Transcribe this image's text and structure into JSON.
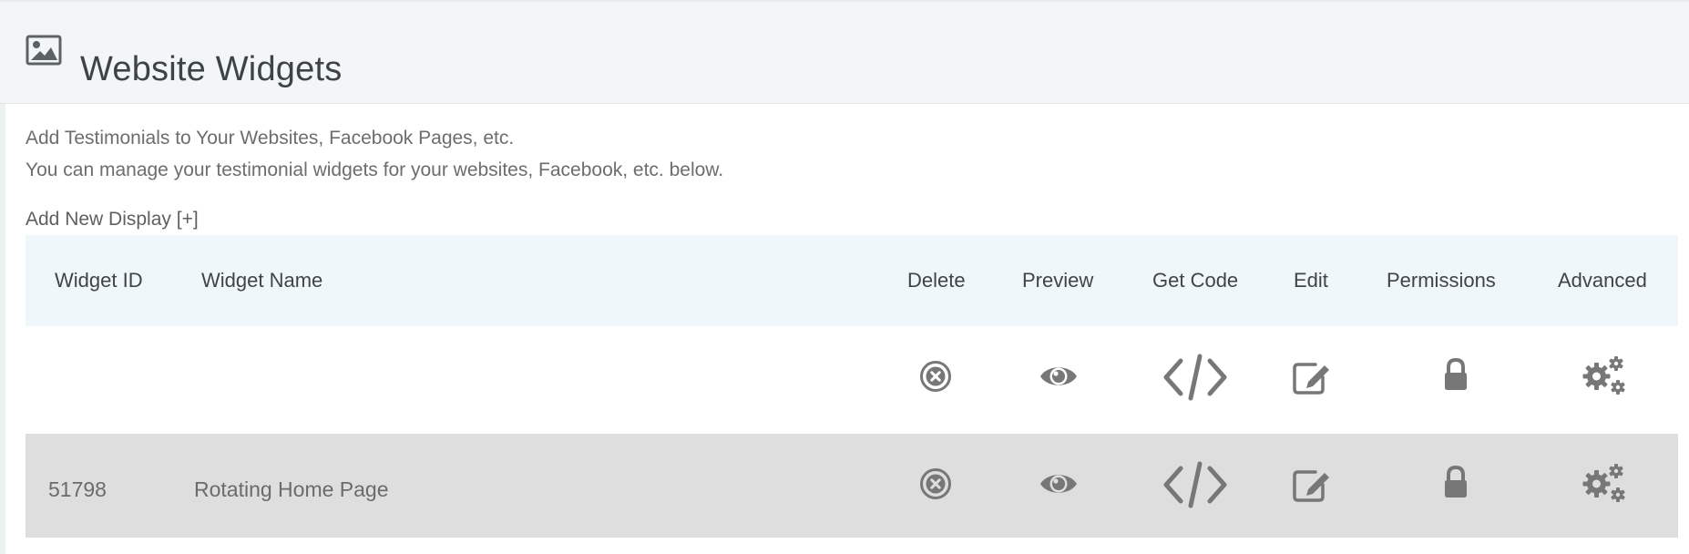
{
  "header": {
    "title": "Website Widgets",
    "icon": "image-icon"
  },
  "intro": {
    "line1": "Add Testimonials to Your Websites, Facebook Pages, etc.",
    "line2": "You can manage your testimonial widgets for your websites, Facebook, etc. below."
  },
  "add_new_label": "Add New Display [+]",
  "table": {
    "columns": [
      "Widget ID",
      "Widget Name",
      "Delete",
      "Preview",
      "Get Code",
      "Edit",
      "Permissions",
      "Advanced"
    ],
    "rows": [
      {
        "widget_id": "",
        "widget_name": ""
      },
      {
        "widget_id": "51798",
        "widget_name": "Rotating Home Page"
      }
    ],
    "action_icons": [
      "delete-icon",
      "eye-icon",
      "code-icon",
      "edit-icon",
      "lock-icon",
      "gears-icon"
    ]
  },
  "colors": {
    "header_bg": "#f3f6f7",
    "table_header_bg": "#f0f7fb",
    "highlight_row_bg": "#dedede",
    "icon_gray": "#777777"
  }
}
